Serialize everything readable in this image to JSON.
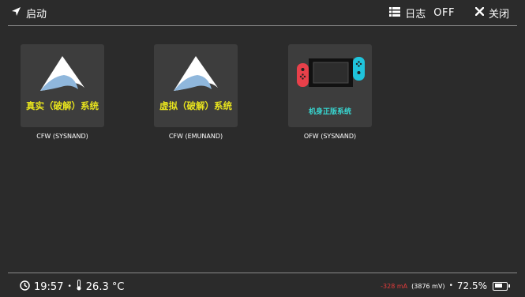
{
  "header": {
    "launch_label": "启动",
    "log_label": "日志",
    "log_state": "OFF",
    "close_label": "关闭"
  },
  "tiles": [
    {
      "title": "真实（破解）系统",
      "caption": "CFW (SYSNAND)",
      "icon": "atmosphere-icon",
      "title_color": "#e6e21e"
    },
    {
      "title": "虚拟（破解）系统",
      "caption": "CFW (EMUNAND)",
      "icon": "atmosphere-icon",
      "title_color": "#e6e21e"
    },
    {
      "title": "机身正版系统",
      "caption": "OFW (SYSNAND)",
      "icon": "nintendo-switch-icon",
      "title_color": "#38d6d1"
    }
  ],
  "status": {
    "time": "19:57",
    "temperature": "26.3 °C",
    "current": "-328 mA",
    "voltage": "(3876 mV)",
    "battery_percent": "72.5%",
    "battery_level": 0.725
  },
  "colors": {
    "background": "#2b2b2b",
    "tile_bg": "#3d3d3d",
    "yellow_title": "#e6e21e",
    "cyan_title": "#38d6d1",
    "current_red": "#e33b3b",
    "joycon_red": "#e8404a",
    "joycon_blue": "#1fc4dc"
  }
}
